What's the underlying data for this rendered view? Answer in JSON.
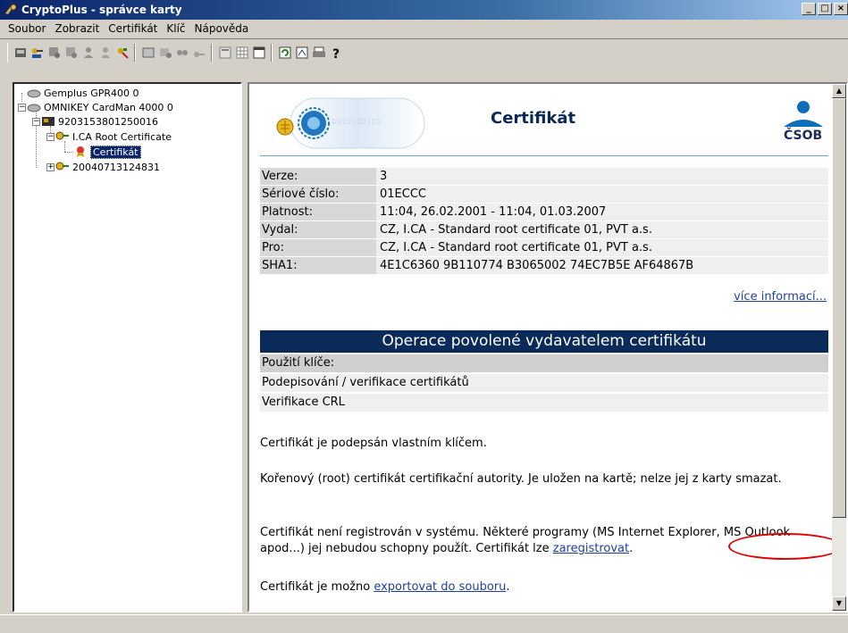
{
  "window": {
    "title": "CryptoPlus - správce karty",
    "buttons": [
      "_",
      "□",
      "×"
    ]
  },
  "menu": [
    "Soubor",
    "Zobrazit",
    "Certifikát",
    "Klíč",
    "Nápověda"
  ],
  "tree": {
    "readers": [
      {
        "label": "Gemplus GPR400 0"
      },
      {
        "label": "OMNIKEY CardMan 4000 0"
      }
    ],
    "card": "9203153801250016",
    "root_cert": "I.CA Root Certificate",
    "selected_cert": "Certifikát",
    "other_cert": "20040713124831"
  },
  "content": {
    "title": "Certifikát",
    "banner_digits": "0010100101",
    "bank_logo": "ČSOB",
    "info": [
      {
        "key": "Verze:",
        "value": "3"
      },
      {
        "key": "Sériové číslo:",
        "value": "01ECCC"
      },
      {
        "key": "Platnost:",
        "value": "11:04, 26.02.2001 - 11:04, 01.03.2007"
      },
      {
        "key": "Vydal:",
        "value": "CZ, I.CA - Standard root certificate 01, PVT a.s."
      },
      {
        "key": "Pro:",
        "value": "CZ, I.CA - Standard root certificate 01, PVT a.s."
      },
      {
        "key": "SHA1:",
        "value": "4E1C6360 9B110774 B3065002 74EC7B5E AF64867B"
      }
    ],
    "more_info_link": "více informací...",
    "operations_title": "Operace povolené vydavatelem certifikátu",
    "operations_header": "Použití klíče:",
    "operations": [
      "Podepisování / verifikace certifikátů",
      "Verifikace CRL"
    ],
    "para_self_signed": "Certifikát je podepsán vlastním klíčem.",
    "para_root": "Kořenový (root) certifikát certifikační autority. Je uložen na kartě; nelze jej z karty smazat.",
    "para_register_prefix": "Certifikát není registrován v systému. Některé programy (MS Internet Explorer, MS Outlook apod...) jej nebudou schopny použít. Certifikát lze ",
    "para_register_link": "zaregistrovat",
    "para_register_suffix": ".",
    "para_export_prefix": "Certifikát je možno ",
    "para_export_link": "exportovat do souboru",
    "para_export_suffix": "."
  },
  "colors": {
    "accent_navy": "#0a2a5a",
    "link": "#1f3fa0",
    "highlight_red": "#e00000"
  }
}
